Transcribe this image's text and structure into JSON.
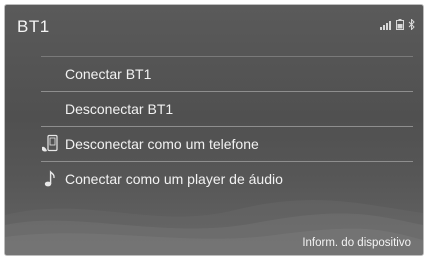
{
  "header": {
    "title": "BT1"
  },
  "status_icons": [
    "signal-bars-icon",
    "battery-icon",
    "bluetooth-icon"
  ],
  "menu": {
    "items": [
      {
        "label": "Conectar BT1",
        "icon": ""
      },
      {
        "label": "Desconectar BT1",
        "icon": ""
      },
      {
        "label": "Desconectar como um telefone",
        "icon": "phone-icon"
      },
      {
        "label": "Conectar como um player de áudio",
        "icon": "music-note-icon"
      }
    ]
  },
  "footer": {
    "device_info_label": "Inform. do dispositivo"
  }
}
